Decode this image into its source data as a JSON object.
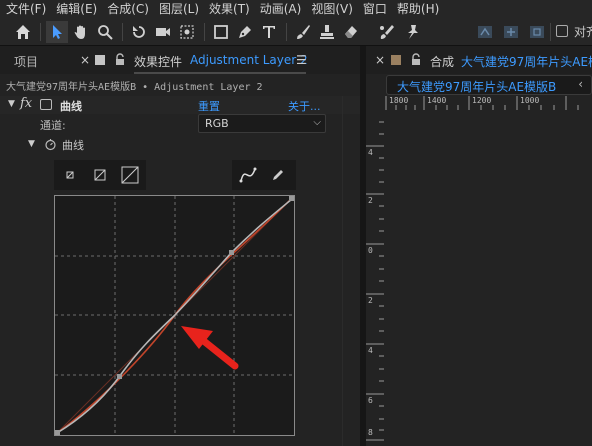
{
  "menu": [
    "文件(F)",
    "编辑(E)",
    "合成(C)",
    "图层(L)",
    "效果(T)",
    "动画(A)",
    "视图(V)",
    "窗口",
    "帮助(H)"
  ],
  "toolbar": {
    "align_label": "对齐"
  },
  "left_panel": {
    "tab_project": "项目",
    "tab_effects": "效果控件",
    "tab_layer": "Adjustment Layer 2",
    "breadcrumb": "大气建党97周年片头AE模版B • Adjustment Layer 2",
    "effect_name": "曲线",
    "reset": "重置",
    "about": "关于...",
    "channel_label": "通道:",
    "channel_value": "RGB",
    "curves_label": "曲线"
  },
  "right_panel": {
    "comp_label": "合成",
    "comp_name": "大气建党97周年片头AE模版B",
    "subtab_name": "大气建党97周年片头AE模版B",
    "ruler_top": [
      "1800",
      "1400",
      "1200",
      "1000"
    ],
    "ruler_left": [
      "4",
      "2",
      "0",
      "2",
      "4",
      "6",
      "8"
    ]
  },
  "colors": {
    "accent_blue": "#3d9bff",
    "curve_rgb": "#b0b0b0",
    "curve_red": "#c0442a",
    "arrow": "#e8231c"
  }
}
